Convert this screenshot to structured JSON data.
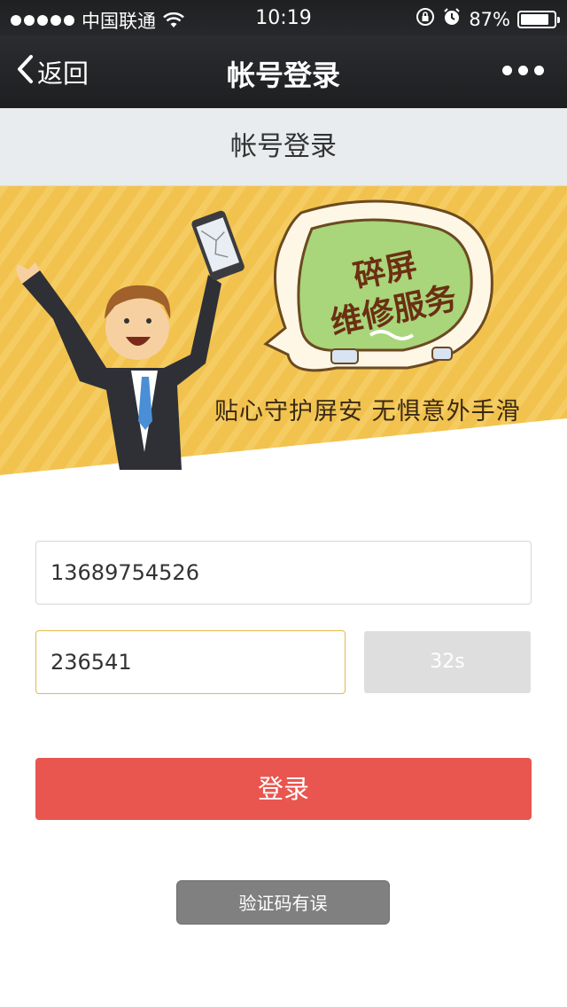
{
  "status_bar": {
    "carrier": "中国联通",
    "time": "10:19",
    "battery": "87%",
    "battery_level": 0.87
  },
  "nav": {
    "back_label": "返回",
    "title": "帐号登录"
  },
  "page_header": {
    "title": "帐号登录"
  },
  "banner": {
    "bubble_line1": "碎屏",
    "bubble_line2": "维修服务",
    "slogan": "贴心守护屏安  无惧意外手滑"
  },
  "form": {
    "phone_value": "13689754526",
    "code_value": "236541",
    "countdown_label": "32s",
    "login_label": "登录"
  },
  "toast": {
    "message": "验证码有误"
  },
  "colors": {
    "accent_red": "#e9564f",
    "banner_yellow": "#f2c24e",
    "code_border": "#e6b84a"
  }
}
